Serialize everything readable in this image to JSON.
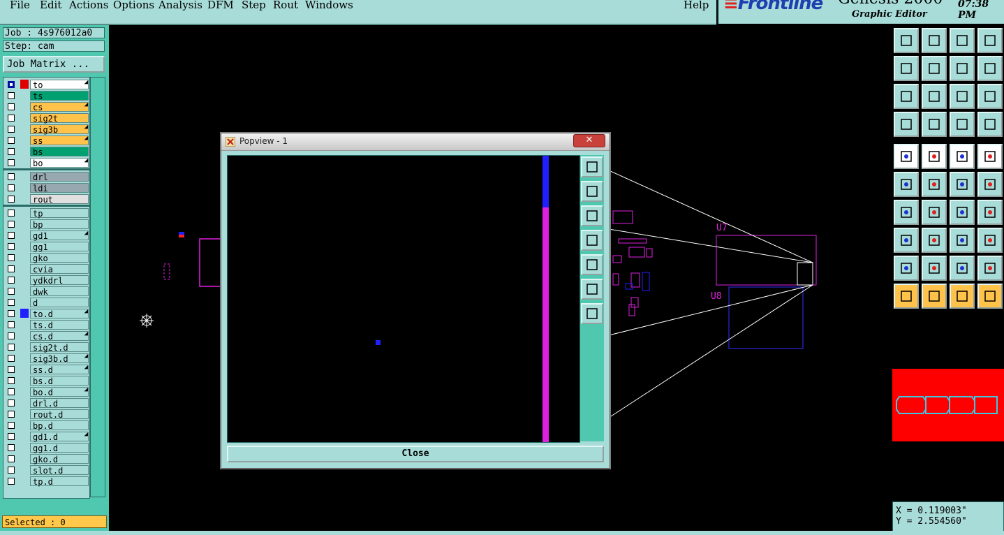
{
  "menu": {
    "items": [
      {
        "label": "File"
      },
      {
        "label": "Edit"
      },
      {
        "label": "Actions"
      },
      {
        "label": "Options"
      },
      {
        "label": "Analysis"
      },
      {
        "label": "DFM"
      },
      {
        "label": "Step"
      },
      {
        "label": "Rout"
      },
      {
        "label": "Windows"
      }
    ],
    "help": "Help"
  },
  "brand": {
    "logo": "Frontline",
    "product": "Genesis 2000",
    "subtitle": "Graphic Editor",
    "time": "07:38 PM"
  },
  "job": {
    "job_text": "Job : 4s976012a0",
    "step_text": "Step: cam",
    "matrix_button": "Job Matrix ..."
  },
  "layers": [
    {
      "name": "to",
      "color": "#ffffff",
      "marker": "#e00000",
      "checked": true,
      "lock": true
    },
    {
      "name": "ts",
      "color": "#00a070",
      "marker": "",
      "checked": false,
      "lock": false
    },
    {
      "name": "cs",
      "color": "#ffc24a",
      "marker": "",
      "checked": false,
      "lock": true
    },
    {
      "name": "sig2t",
      "color": "#ffc24a",
      "marker": "",
      "checked": false,
      "lock": false
    },
    {
      "name": "sig3b",
      "color": "#ffc24a",
      "marker": "",
      "checked": false,
      "lock": true
    },
    {
      "name": "ss",
      "color": "#ffc24a",
      "marker": "",
      "checked": false,
      "lock": true
    },
    {
      "name": "bs",
      "color": "#00a070",
      "marker": "",
      "checked": false,
      "lock": false
    },
    {
      "name": "bo",
      "color": "#ffffff",
      "marker": "",
      "checked": false,
      "lock": true
    },
    {
      "name": "drl",
      "color": "#98a8b0",
      "marker": "",
      "checked": false,
      "lock": false,
      "group_start": true
    },
    {
      "name": "ldi",
      "color": "#98a8b0",
      "marker": "",
      "checked": false,
      "lock": false
    },
    {
      "name": "rout",
      "color": "#e0e0e0",
      "marker": "",
      "checked": false,
      "lock": false
    },
    {
      "name": "tp",
      "color": "#a8dcd8",
      "marker": "",
      "checked": false,
      "lock": false,
      "group_start": true
    },
    {
      "name": "bp",
      "color": "#a8dcd8",
      "marker": "",
      "checked": false,
      "lock": false
    },
    {
      "name": "gd1",
      "color": "#a8dcd8",
      "marker": "",
      "checked": false,
      "lock": true
    },
    {
      "name": "gg1",
      "color": "#a8dcd8",
      "marker": "",
      "checked": false,
      "lock": false
    },
    {
      "name": "gko",
      "color": "#a8dcd8",
      "marker": "",
      "checked": false,
      "lock": false
    },
    {
      "name": "cvia",
      "color": "#a8dcd8",
      "marker": "",
      "checked": false,
      "lock": false
    },
    {
      "name": "ydkdrl",
      "color": "#a8dcd8",
      "marker": "",
      "checked": false,
      "lock": false
    },
    {
      "name": "dwk",
      "color": "#a8dcd8",
      "marker": "",
      "checked": false,
      "lock": false
    },
    {
      "name": "d",
      "color": "#a8dcd8",
      "marker": "",
      "checked": false,
      "lock": false
    },
    {
      "name": "to.d",
      "color": "#a8dcd8",
      "marker": "#2020ff",
      "checked": false,
      "lock": true
    },
    {
      "name": "ts.d",
      "color": "#a8dcd8",
      "marker": "",
      "checked": false,
      "lock": false
    },
    {
      "name": "cs.d",
      "color": "#a8dcd8",
      "marker": "",
      "checked": false,
      "lock": true
    },
    {
      "name": "sig2t.d",
      "color": "#a8dcd8",
      "marker": "",
      "checked": false,
      "lock": false
    },
    {
      "name": "sig3b.d",
      "color": "#a8dcd8",
      "marker": "",
      "checked": false,
      "lock": true
    },
    {
      "name": "ss.d",
      "color": "#a8dcd8",
      "marker": "",
      "checked": false,
      "lock": true
    },
    {
      "name": "bs.d",
      "color": "#a8dcd8",
      "marker": "",
      "checked": false,
      "lock": false
    },
    {
      "name": "bo.d",
      "color": "#a8dcd8",
      "marker": "",
      "checked": false,
      "lock": true
    },
    {
      "name": "drl.d",
      "color": "#a8dcd8",
      "marker": "",
      "checked": false,
      "lock": false
    },
    {
      "name": "rout.d",
      "color": "#a8dcd8",
      "marker": "",
      "checked": false,
      "lock": false
    },
    {
      "name": "bp.d",
      "color": "#a8dcd8",
      "marker": "",
      "checked": false,
      "lock": false
    },
    {
      "name": "gd1.d",
      "color": "#a8dcd8",
      "marker": "",
      "checked": false,
      "lock": true
    },
    {
      "name": "gg1.d",
      "color": "#a8dcd8",
      "marker": "",
      "checked": false,
      "lock": false
    },
    {
      "name": "gko.d",
      "color": "#a8dcd8",
      "marker": "",
      "checked": false,
      "lock": false
    },
    {
      "name": "slot.d",
      "color": "#a8dcd8",
      "marker": "",
      "checked": false,
      "lock": false
    },
    {
      "name": "tp.d",
      "color": "#a8dcd8",
      "marker": "",
      "checked": false,
      "lock": false
    }
  ],
  "status": {
    "selected_text": "Selected : 0"
  },
  "coords": {
    "x_text": "X = 0.119003\"",
    "y_text": "Y = 2.554560\""
  },
  "canvas_text": {
    "u7": "U7",
    "u8": "U8"
  },
  "popview": {
    "title": "Popview - 1",
    "close_label": "Close",
    "close_x": "✕"
  },
  "colors": {
    "panel": "#a8dcd8",
    "panel_dark": "#50c8b0",
    "magenta": "#e020e0",
    "blue": "#2020ff",
    "red": "#ff0000",
    "cyan": "#40c8e0"
  }
}
